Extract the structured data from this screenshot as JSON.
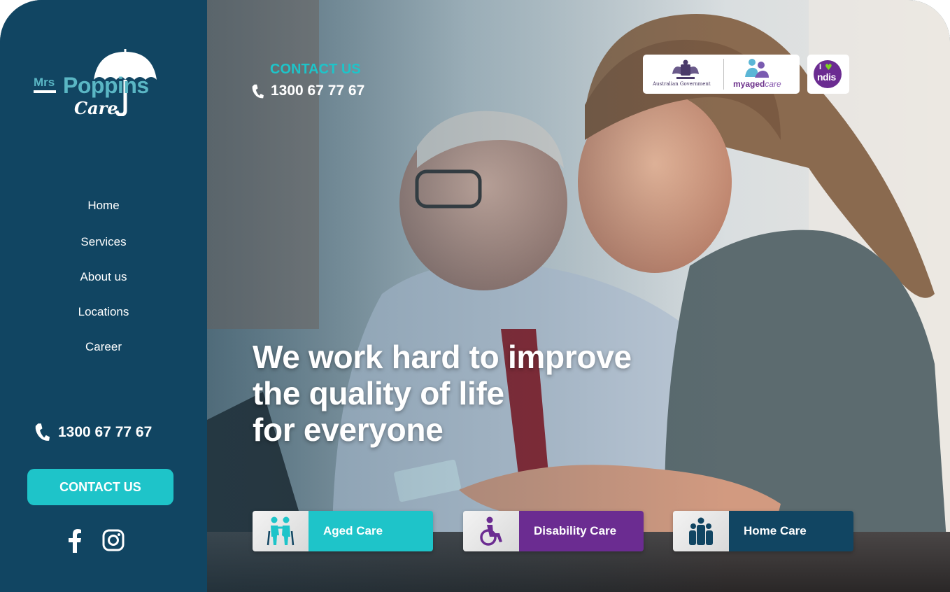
{
  "brand": {
    "logo_mrs": "Mrs",
    "logo_poppins": "Poppins",
    "logo_care": "Care",
    "logo_u": "U"
  },
  "sidebar": {
    "nav": [
      {
        "label": "Home"
      },
      {
        "label": "Services"
      },
      {
        "label": "About us"
      },
      {
        "label": "Locations"
      },
      {
        "label": "Career"
      }
    ],
    "phone": "1300 67 77 67",
    "cta_label": "CONTACT US",
    "social": [
      "facebook-icon",
      "instagram-icon"
    ]
  },
  "header": {
    "contact_label": "CONTACT US",
    "phone": "1300 67 77 67",
    "gov_badge": {
      "gov_text": "Australian Government",
      "myagedcare_bold": "myaged",
      "myagedcare_light": "care"
    },
    "ndis_badge": {
      "i_text": "I",
      "ndis_text": "ndis"
    }
  },
  "hero": {
    "headline": [
      "We work hard to improve",
      "the quality of life",
      "for everyone"
    ]
  },
  "services": [
    {
      "label": "Aged Care",
      "color": "#1ec4c9",
      "icon": "elderly-couple-icon"
    },
    {
      "label": "Disability Care",
      "color": "#6b2c91",
      "icon": "wheelchair-icon"
    },
    {
      "label": "Home Care",
      "color": "#114562",
      "icon": "family-group-icon"
    }
  ],
  "colors": {
    "sidebar": "#114562",
    "accent": "#1ec4c9",
    "purple": "#6b2c91"
  }
}
